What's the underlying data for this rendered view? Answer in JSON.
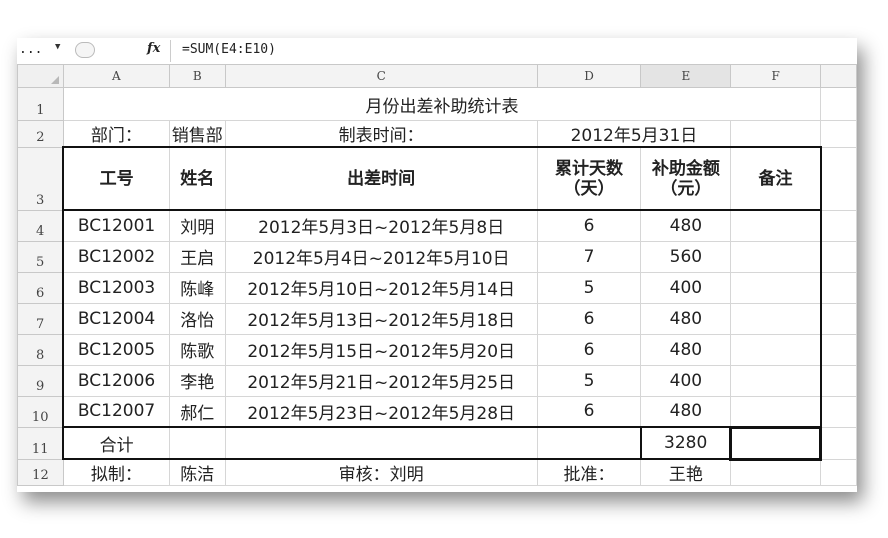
{
  "formula_bar": {
    "name_box": "...",
    "fx": "fx",
    "formula": "=SUM(E4:E10)"
  },
  "columns": [
    "A",
    "B",
    "C",
    "D",
    "E",
    "F"
  ],
  "rows": [
    "1",
    "2",
    "3",
    "4",
    "5",
    "6",
    "7",
    "8",
    "9",
    "10",
    "11",
    "12"
  ],
  "sheet": {
    "title": "月份出差补助统计表",
    "dept_label": "部门：",
    "dept_value": "销售部",
    "made_time_label": "制表时间：",
    "made_time_value": "2012年5月31日",
    "headers": {
      "id": "工号",
      "name": "姓名",
      "trip_time": "出差时间",
      "days": "累计天数\n（天）",
      "amount": "补助金额\n（元）",
      "note": "备注"
    },
    "records": [
      {
        "id": "BC12001",
        "name": "刘明",
        "period": "2012年5月3日~2012年5月8日",
        "days": "6",
        "amount": "480",
        "note": ""
      },
      {
        "id": "BC12002",
        "name": "王启",
        "period": "2012年5月4日~2012年5月10日",
        "days": "7",
        "amount": "560",
        "note": ""
      },
      {
        "id": "BC12003",
        "name": "陈峰",
        "period": "2012年5月10日~2012年5月14日",
        "days": "5",
        "amount": "400",
        "note": ""
      },
      {
        "id": "BC12004",
        "name": "洛怡",
        "period": "2012年5月13日~2012年5月18日",
        "days": "6",
        "amount": "480",
        "note": ""
      },
      {
        "id": "BC12005",
        "name": "陈歌",
        "period": "2012年5月15日~2012年5月20日",
        "days": "6",
        "amount": "480",
        "note": ""
      },
      {
        "id": "BC12006",
        "name": "李艳",
        "period": "2012年5月21日~2012年5月25日",
        "days": "5",
        "amount": "400",
        "note": ""
      },
      {
        "id": "BC12007",
        "name": "郝仁",
        "period": "2012年5月23日~2012年5月28日",
        "days": "6",
        "amount": "480",
        "note": ""
      }
    ],
    "total_label": "合计",
    "total_value": "3280",
    "footer": {
      "drafted_label": "拟制：",
      "drafted_value": "陈洁",
      "reviewed": "审核：刘明",
      "approved_label": "批准：",
      "approved_value": "王艳"
    }
  }
}
